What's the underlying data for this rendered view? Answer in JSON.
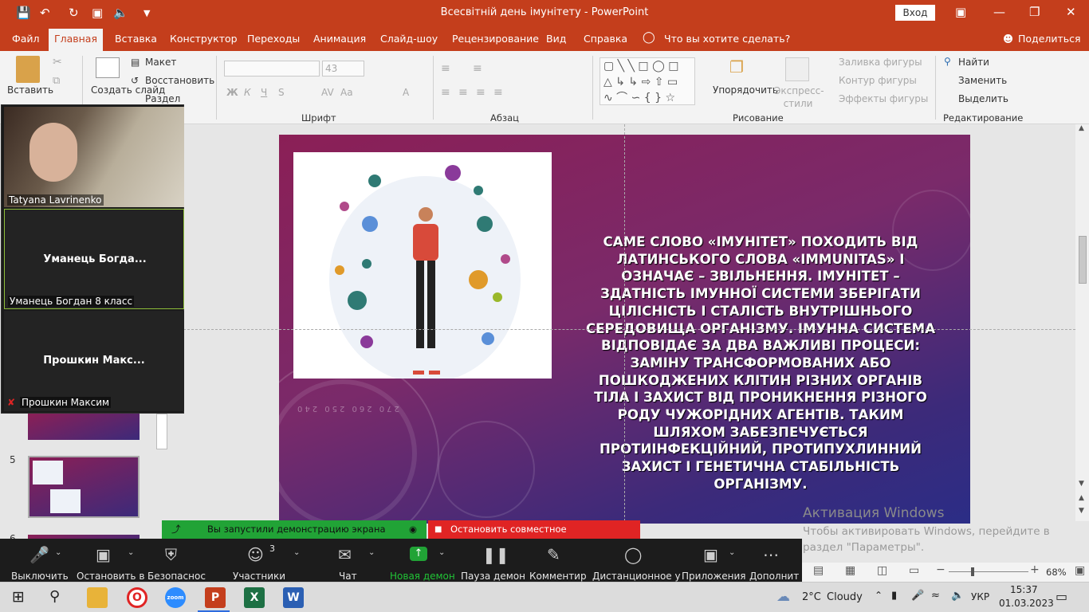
{
  "titlebar": {
    "title": "Всесвітній день імунітету  -  PowerPoint",
    "login": "Вход"
  },
  "tabs": [
    "Файл",
    "Главная",
    "Вставка",
    "Конструктор",
    "Переходы",
    "Анимация",
    "Слайд-шоу",
    "Рецензирование",
    "Вид",
    "Справка",
    "Что вы хотите сделать?"
  ],
  "share_label": "Поделиться",
  "ribbon": {
    "paste": "Вставить",
    "create_slide": "Создать слайд",
    "layout": "Макет",
    "reset": "Восстановить",
    "section": "Раздел",
    "font_size": "43",
    "font_group": "Шрифт",
    "paragraph_group": "Абзац",
    "arrange": "Упорядочить",
    "express_styles": "Экспресс-стили",
    "shape_fill": "Заливка фигуры",
    "shape_outline": "Контур фигуры",
    "shape_effects": "Эффекты фигуры",
    "drawing_group": "Рисование",
    "find": "Найти",
    "replace": "Заменить",
    "select": "Выделить",
    "editing_group": "Редактирование"
  },
  "slide": {
    "text": "САМЕ СЛОВО «ІМУНІТЕТ» ПОХОДИТЬ ВІД ЛАТИНСЬКОГО СЛОВА «IMMUNITAS» І ОЗНАЧАЄ – ЗВІЛЬНЕННЯ. ІМУНІТЕТ – ЗДАТНІСТЬ ІМУННОЇ СИСТЕМИ ЗБЕРІГАТИ ЦІЛІСНІСТЬ І СТАЛІСТЬ ВНУТРІШНЬОГО СЕРЕДОВИЩА ОРГАНІЗМУ. ІМУННА СИСТЕМА ВІДПОВІДАЄ ЗА ДВА ВАЖЛИВІ ПРОЦЕСИ: ЗАМІНУ ТРАНСФОРМОВАНИХ АБО ПОШКОДЖЕНИХ КЛІТИН РІЗНИХ ОРГАНІВ ТІЛА І ЗАХИСТ ВІД ПРОНИКНЕННЯ РІЗНОГО РОДУ ЧУЖОРІДНИХ АГЕНТІВ. ТАКИМ ШЛЯХОМ ЗАБЕЗПЕЧУЄТЬСЯ ПРОТИІНФЕКЦІЙНИЙ, ПРОТИПУХЛИННИЙ ЗАХИСТ І ГЕНЕТИЧНА СТАБІЛЬНІСТЬ ОРГАНІЗМУ.",
    "dial_numbers": "270 260 250 240"
  },
  "activation": {
    "title": "Активация Windows",
    "line": "Чтобы активировать Windows, перейдите в раздел \"Параметры\"."
  },
  "thumbnails": {
    "num5": "5",
    "num6": "6"
  },
  "participants_panel": {
    "p1_name": "Tatyana Lavrinenko",
    "p2_big": "Уманець  Богда...",
    "p2_small": "Уманець Богдан 8 класс",
    "p3_big": "Прошкин  Макс...",
    "p3_small": "Прошкин Максим"
  },
  "share_banner": {
    "status": "Вы запустили демонстрацию экрана",
    "stop": "Остановить совместное использование"
  },
  "zoom_toolbar": {
    "mute": "Выключить",
    "stop_video": "Остановить в",
    "security": "Безопаснос",
    "participants": "Участники",
    "participants_count": "3",
    "chat": "Чат",
    "new_share": "Новая демон",
    "pause_share": "Пауза демон",
    "annotate": "Комментир",
    "remote": "Дистанционное у",
    "apps": "Приложения",
    "more": "Дополнит"
  },
  "statusbar": {
    "zoom": "68%"
  },
  "taskbar": {
    "weather_temp": "2°C",
    "weather_text": "Cloudy",
    "lang": "УКР",
    "time": "15:37",
    "date": "01.03.2023"
  },
  "colors": {
    "office_red": "#c43e1c",
    "zoom_green": "#21a336",
    "zoom_red": "#e02424"
  }
}
